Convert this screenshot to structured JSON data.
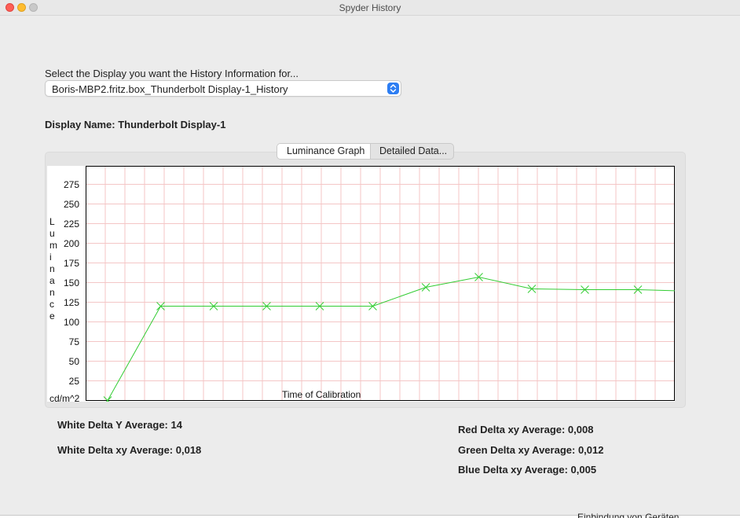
{
  "window": {
    "title": "Spyder History"
  },
  "prompt": "Select the Display you want the History Information for...",
  "display_select": {
    "value": "Boris-MBP2.fritz.box_Thunderbolt Display-1_History"
  },
  "display_name": "Display Name: Thunderbolt Display-1",
  "tabs": [
    {
      "label": "Luminance Graph",
      "selected": true
    },
    {
      "label": "Detailed Data...",
      "selected": false
    }
  ],
  "chart_data": {
    "type": "line",
    "title": "",
    "xlabel": "Time of Calibration",
    "ylabel": "Luminance",
    "yunit": "cd/m^2",
    "yticks": [
      25,
      50,
      75,
      100,
      125,
      150,
      175,
      200,
      225,
      250,
      275
    ],
    "ylim": [
      0,
      300
    ],
    "grid": true,
    "colors": {
      "line": "#33cc33",
      "grid": "#f4c6c6"
    },
    "series": [
      {
        "values": [
          0,
          120,
          120,
          120,
          120,
          120,
          144,
          157,
          142,
          141,
          141,
          139
        ]
      }
    ]
  },
  "stats": {
    "white_delta_y": "White Delta Y Average: 14",
    "white_delta_xy": "White Delta xy Average: 0,018",
    "red_delta_xy": "Red Delta xy Average: 0,008",
    "green_delta_xy": "Green Delta xy Average: 0,012",
    "blue_delta_xy": "Blue Delta xy Average: 0,005"
  },
  "background_text": "Einbindung von Geräten"
}
